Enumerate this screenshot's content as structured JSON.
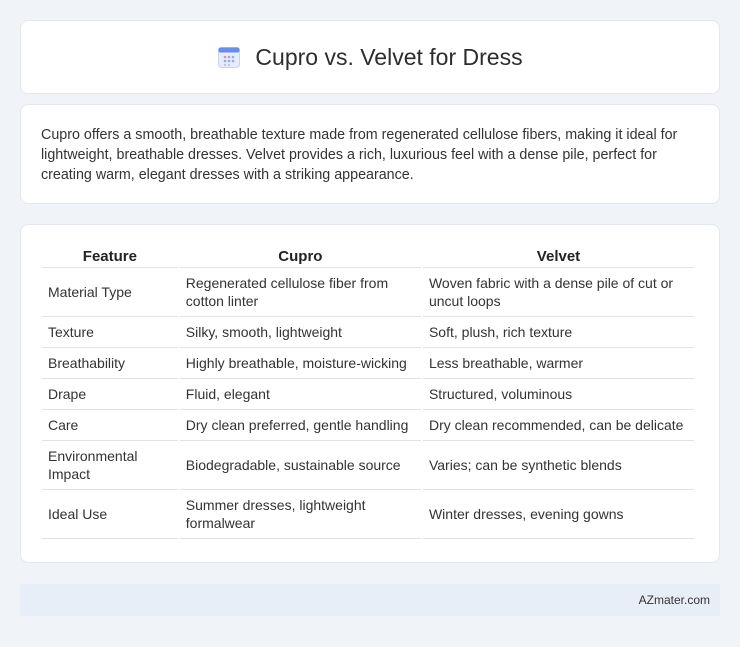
{
  "header": {
    "title": "Cupro vs. Velvet for Dress",
    "icon": "calendar-icon",
    "accent": "#6b8de3"
  },
  "intro": {
    "text": "Cupro offers a smooth, breathable texture made from regenerated cellulose fibers, making it ideal for lightweight, breathable dresses. Velvet provides a rich, luxurious feel with a dense pile, perfect for creating warm, elegant dresses with a striking appearance."
  },
  "table": {
    "headers": [
      "Feature",
      "Cupro",
      "Velvet"
    ],
    "rows": [
      [
        "Material Type",
        "Regenerated cellulose fiber from cotton linter",
        "Woven fabric with a dense pile of cut or uncut loops"
      ],
      [
        "Texture",
        "Silky, smooth, lightweight",
        "Soft, plush, rich texture"
      ],
      [
        "Breathability",
        "Highly breathable, moisture-wicking",
        "Less breathable, warmer"
      ],
      [
        "Drape",
        "Fluid, elegant",
        "Structured, voluminous"
      ],
      [
        "Care",
        "Dry clean preferred, gentle handling",
        "Dry clean recommended, can be delicate"
      ],
      [
        "Environmental Impact",
        "Biodegradable, sustainable source",
        "Varies; can be synthetic blends"
      ],
      [
        "Ideal Use",
        "Summer dresses, lightweight formalwear",
        "Winter dresses, evening gowns"
      ]
    ]
  },
  "footer": {
    "text": "AZmater.com"
  }
}
